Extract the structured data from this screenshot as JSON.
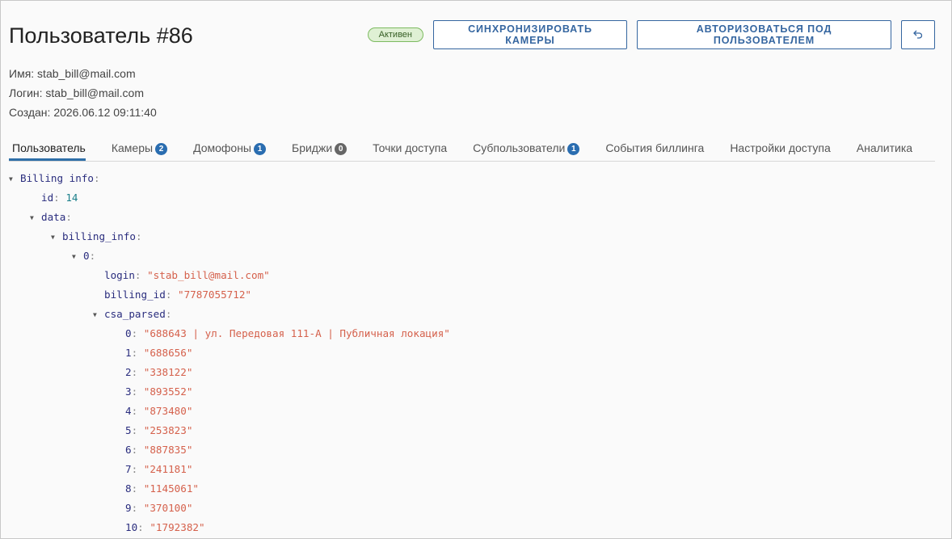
{
  "header": {
    "title": "Пользователь #86",
    "status": "Активен",
    "sync_label": "СИНХРОНИЗИРОВАТЬ КАМЕРЫ",
    "login_as_label": "АВТОРИЗОВАТЬСЯ ПОД ПОЛЬЗОВАТЕЛЕМ",
    "back_icon": "undo-arrow-icon"
  },
  "info": {
    "name": "Имя: stab_bill@mail.com",
    "login": "Логин: stab_bill@mail.com",
    "created": "Создан: 2026.06.12 09:11:40"
  },
  "tabs": [
    {
      "label": "Пользователь",
      "active": true
    },
    {
      "label": "Камеры",
      "count": "2"
    },
    {
      "label": "Домофоны",
      "count": "1"
    },
    {
      "label": "Бриджи",
      "count": "0"
    },
    {
      "label": "Точки доступа"
    },
    {
      "label": "Субпользователи",
      "count": "1"
    },
    {
      "label": "События биллинга"
    },
    {
      "label": "Настройки доступа"
    },
    {
      "label": "Аналитика"
    }
  ],
  "colors": {
    "accent": "#3566a0",
    "tab_underline": "#2f6fa8",
    "badge_blue": "#2a6db0",
    "badge_gray": "#666666",
    "status_bg": "#dff0d4",
    "status_border": "#7dbb61",
    "tree_key": "#2a2d7e",
    "tree_string": "#d5614c",
    "tree_number": "#1a7f8a"
  },
  "tree": {
    "root_key": "Billing info",
    "id_key": "id",
    "id_value": "14",
    "data_key": "data",
    "billing_info_key": "billing_info",
    "item_key": "0",
    "login_key": "login",
    "login_value": "\"stab_bill@mail.com\"",
    "billing_id_key": "billing_id",
    "billing_id_value": "\"7787055712\"",
    "csa_parsed_key": "csa_parsed",
    "csa_parsed": [
      {
        "index": "0",
        "value": "\"688643 | ул. Передовая 111-А | Публичная локация\""
      },
      {
        "index": "1",
        "value": "\"688656\""
      },
      {
        "index": "2",
        "value": "\"338122\""
      },
      {
        "index": "3",
        "value": "\"893552\""
      },
      {
        "index": "4",
        "value": "\"873480\""
      },
      {
        "index": "5",
        "value": "\"253823\""
      },
      {
        "index": "6",
        "value": "\"887835\""
      },
      {
        "index": "7",
        "value": "\"241181\""
      },
      {
        "index": "8",
        "value": "\"1145061\""
      },
      {
        "index": "9",
        "value": "\"370100\""
      },
      {
        "index": "10",
        "value": "\"1792382\""
      }
    ]
  }
}
